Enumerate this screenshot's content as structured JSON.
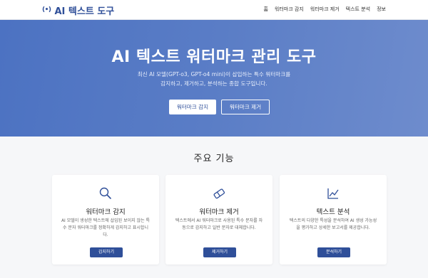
{
  "nav": {
    "brand_icon": "(•)",
    "brand": "AI 텍스트 도구",
    "items": [
      "홈",
      "워터마크 감지",
      "워터마크 제거",
      "텍스트 분석",
      "정보"
    ]
  },
  "hero": {
    "title": "AI 텍스트 워터마크 관리 도구",
    "desc_line1": "최신 AI 모델(GPT-o3, GPT-o4 mini)이 삽입하는 특수 워터마크를",
    "desc_line2": "감지하고, 제거하고, 분석하는 종합 도구입니다.",
    "btn_detect": "워터마크 감지",
    "btn_remove": "워터마크 제거"
  },
  "features": {
    "title": "주요 기능",
    "cards": [
      {
        "icon": "search-icon",
        "title": "워터마크 감지",
        "desc_line1": "AI 모델이 생성한 텍스트에 삽입된 보이지 않는 특",
        "desc_line2": "수 문자 워터마크를 정확하게 감지하고 표시합니",
        "desc_line3": "다.",
        "button": "감지하기"
      },
      {
        "icon": "eraser-icon",
        "title": "워터마크 제거",
        "desc_line1": "텍스트에서 AI 워터마크로 사용된 특수 문자를 자",
        "desc_line2": "동으로 감지하고 일반 문자로 대체합니다.",
        "desc_line3": "",
        "button": "제거하기"
      },
      {
        "icon": "line-chart-icon",
        "title": "텍스트 분석",
        "desc_line1": "텍스트의 다양한 특성을 분석하여 AI 생성 가능성",
        "desc_line2": "을 평가하고 상세한 보고서를 제공합니다.",
        "desc_line3": "",
        "button": "분석하기"
      }
    ]
  },
  "colors": {
    "brand": "#2f4f99",
    "hero_start": "#4c72c2",
    "hero_end": "#6e8ccd"
  }
}
